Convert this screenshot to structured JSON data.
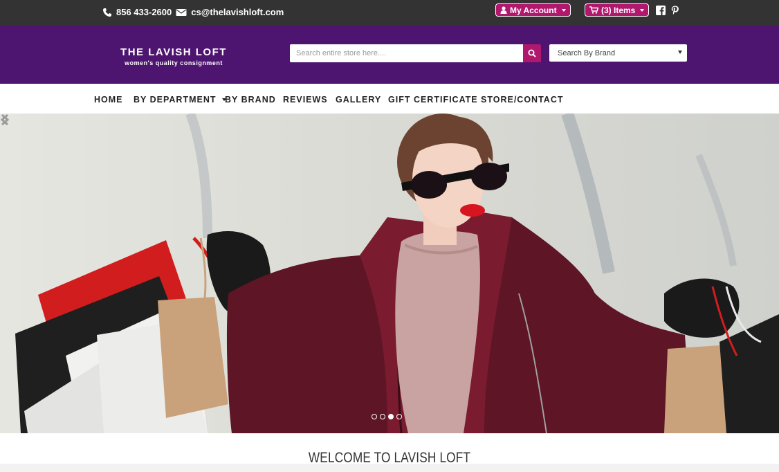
{
  "topbar": {
    "phone": "856 433-2600",
    "email": "cs@thelavishloft.com",
    "account_label": "My Account",
    "cart_label": "(3) Items",
    "icons": {
      "phone": "phone-icon",
      "email": "envelope-icon",
      "user": "user-icon",
      "cart": "cart-icon",
      "facebook": "facebook-icon",
      "pinterest": "pinterest-icon"
    }
  },
  "header": {
    "logo_main": "THE LAVISH LOFT",
    "logo_sub": "women's quality consignment",
    "search_placeholder": "Search entire store here....",
    "brand_select": "Search By Brand"
  },
  "nav": {
    "items": [
      {
        "label": "HOME"
      },
      {
        "label": "BY DEPARTMENT"
      },
      {
        "label": "BY BRAND"
      },
      {
        "label": "REVIEWS"
      },
      {
        "label": "GALLERY"
      },
      {
        "label": "GIFT CERTIFICATE"
      },
      {
        "label": "STORE/CONTACT"
      }
    ]
  },
  "hero": {
    "slides_total": 4,
    "active_slide": 3
  },
  "welcome": {
    "title": "WELCOME TO LAVISH LOFT"
  },
  "colors": {
    "topbar": "#333333",
    "header": "#4d1470",
    "accent": "#b0186e"
  }
}
